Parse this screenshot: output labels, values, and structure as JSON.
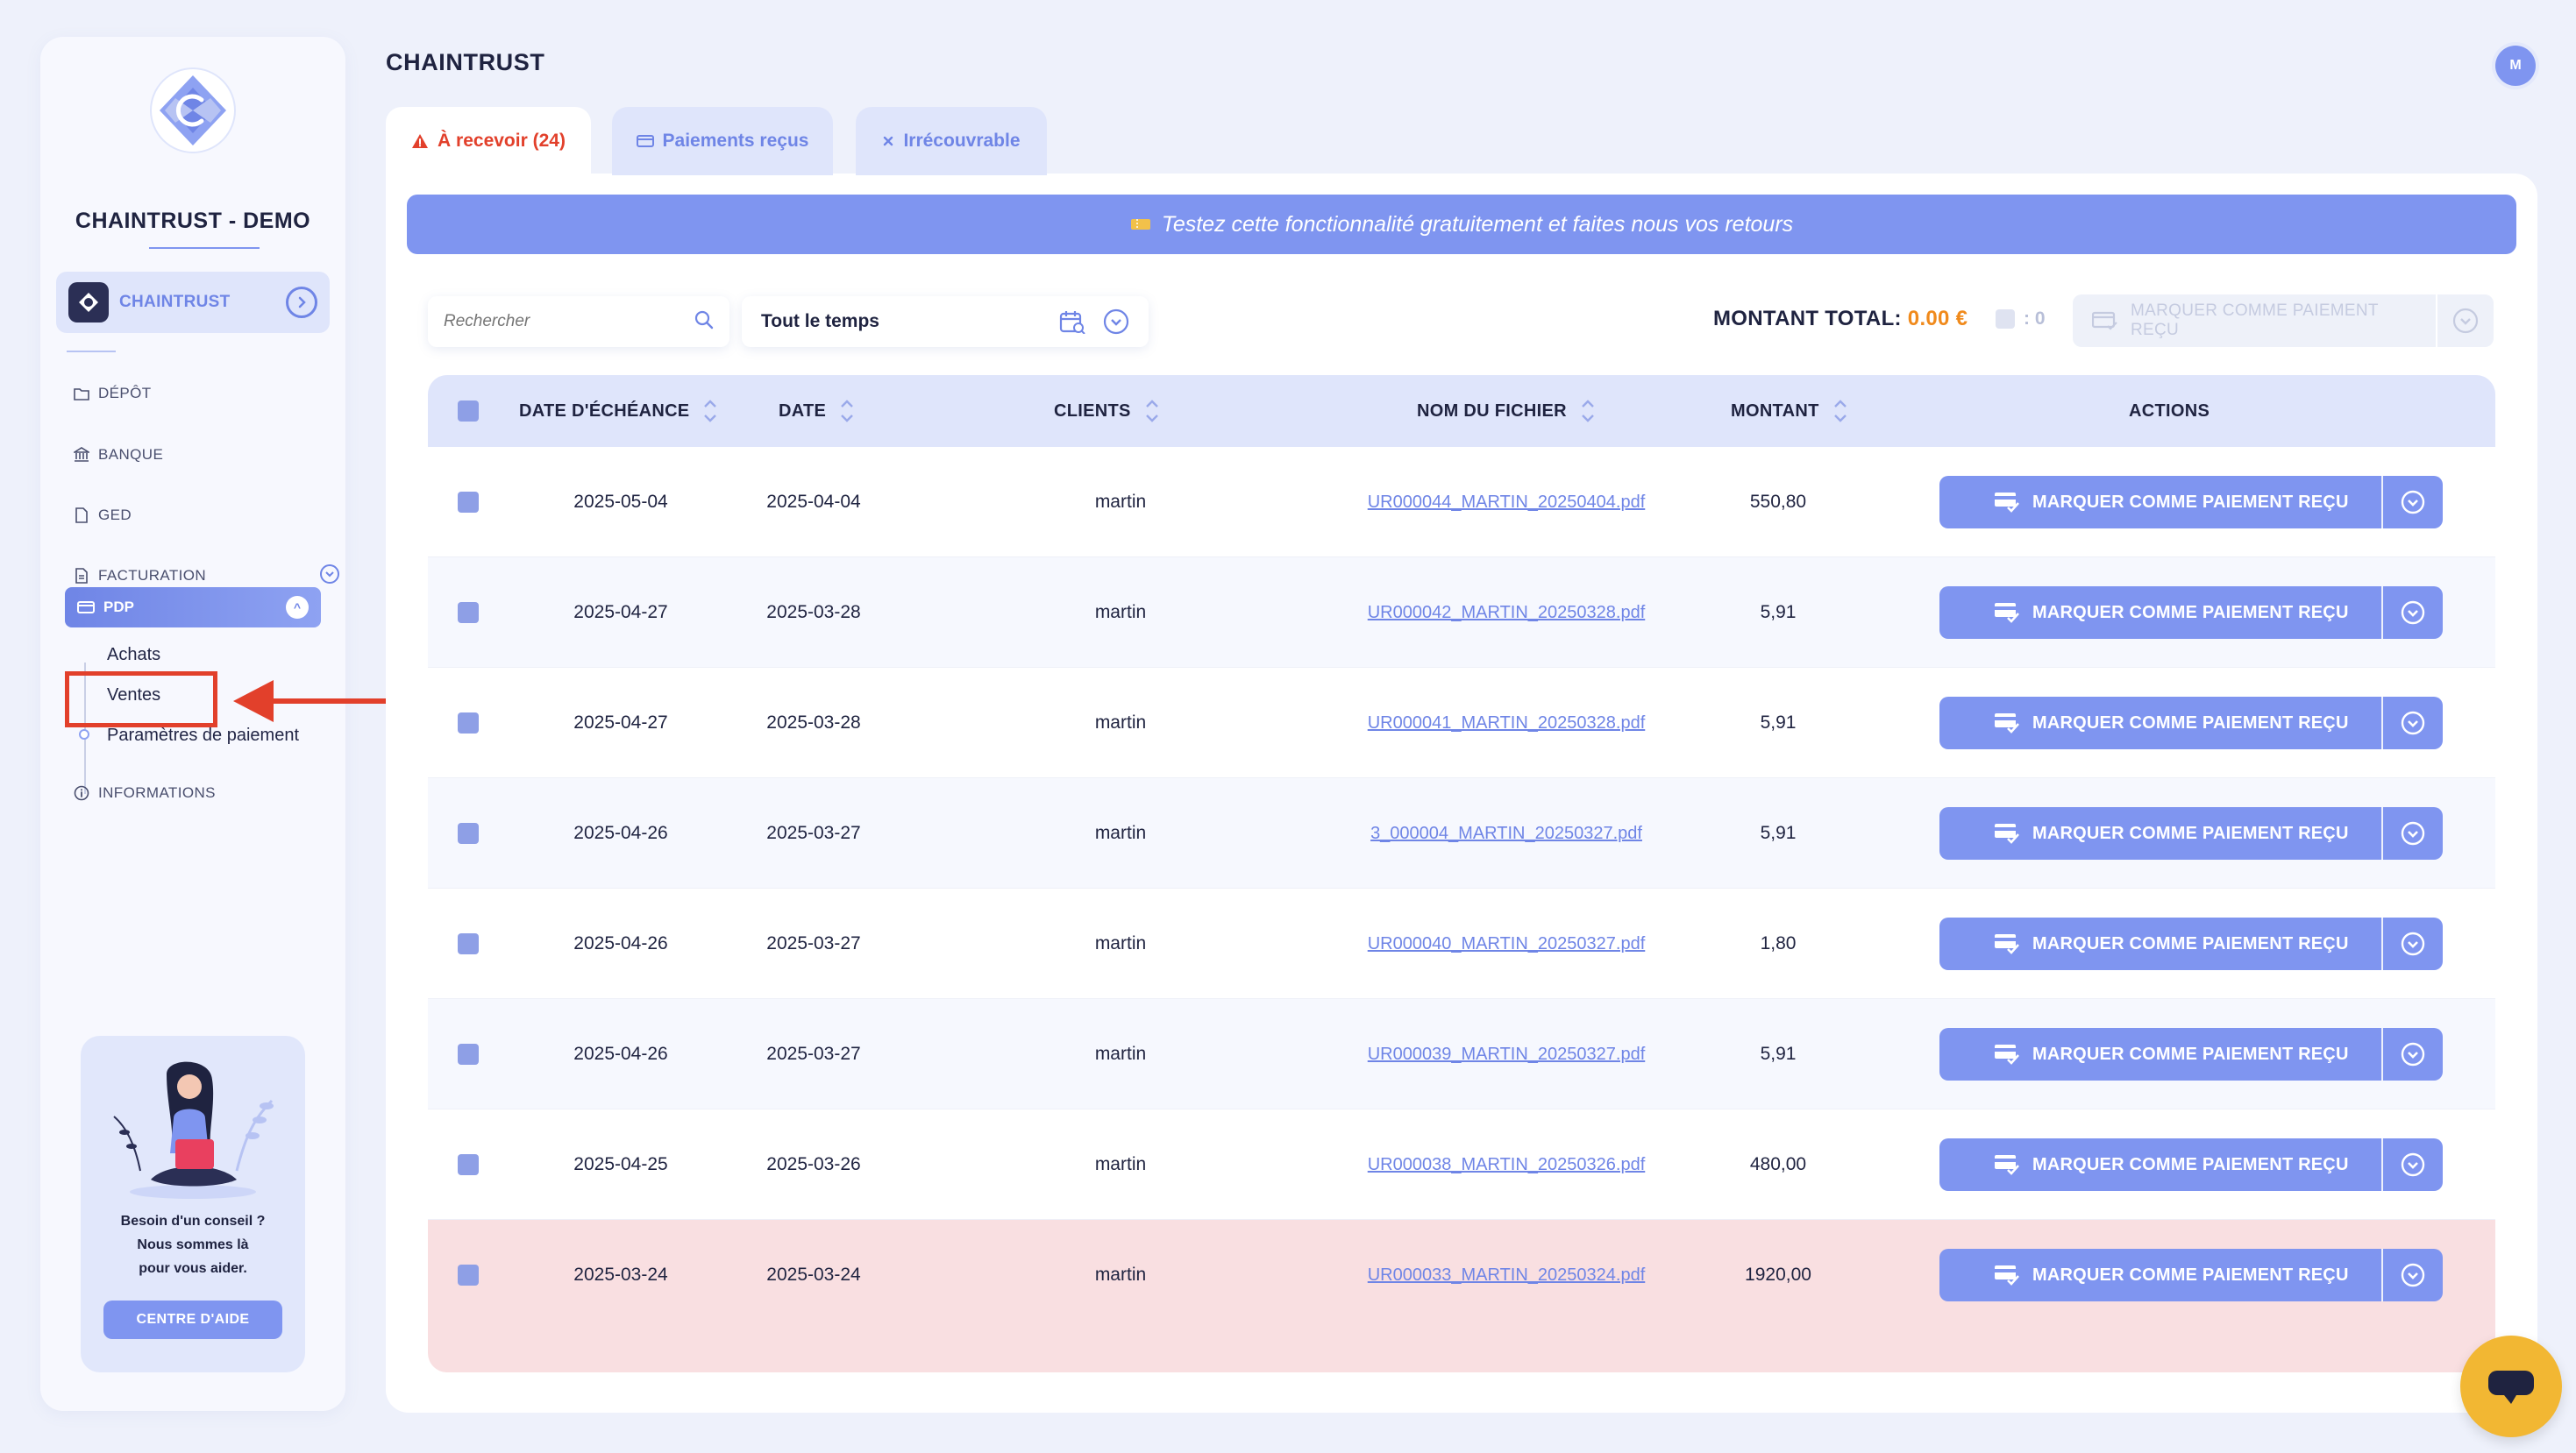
{
  "app": {
    "title": "CHAINTRUST",
    "avatar_initial": "M"
  },
  "sidebar": {
    "brand": "CHAINTRUST - DEMO",
    "org_label": "CHAINTRUST",
    "items": [
      {
        "label": "DÉPÔT",
        "icon": "folder-icon"
      },
      {
        "label": "BANQUE",
        "icon": "bank-icon"
      },
      {
        "label": "GED",
        "icon": "document-icon"
      },
      {
        "label": "FACTURATION",
        "icon": "invoice-icon"
      },
      {
        "label": "PDP",
        "icon": "card-icon"
      },
      {
        "label": "INFORMATIONS",
        "icon": "info-icon"
      }
    ],
    "pdp_sub": [
      "Achats",
      "Ventes",
      "Paramètres de paiement"
    ],
    "help": {
      "line1": "Besoin d'un conseil ?",
      "line2": "Nous sommes là",
      "line3": "pour vous aider.",
      "button": "CENTRE D'AIDE"
    }
  },
  "tabs": [
    {
      "label": "À recevoir (24)",
      "icon": "warning-icon"
    },
    {
      "label": "Paiements reçus",
      "icon": "card-icon"
    },
    {
      "label": "Irrécouvrable",
      "icon": "close-icon"
    }
  ],
  "banner": "Testez cette fonctionnalité gratuitement et faites nous vos retours",
  "toolbar": {
    "search_placeholder": "Rechercher",
    "period": "Tout le temps",
    "total_label": "MONTANT TOTAL:",
    "total_value": "0.00 €",
    "selected_count": ": 0",
    "bulk_button": "MARQUER COMME PAIEMENT REÇU"
  },
  "table": {
    "columns": [
      "DATE D'ÉCHÉANCE",
      "DATE",
      "CLIENTS",
      "NOM DU FICHIER",
      "MONTANT",
      "ACTIONS"
    ],
    "action_label": "MARQUER COMME PAIEMENT REÇU",
    "rows": [
      {
        "due": "2025-05-04",
        "date": "2025-04-04",
        "client": "martin",
        "file": "UR000044_MARTIN_20250404.pdf",
        "amount": "550,80",
        "overdue": false
      },
      {
        "due": "2025-04-27",
        "date": "2025-03-28",
        "client": "martin",
        "file": "UR000042_MARTIN_20250328.pdf",
        "amount": "5,91",
        "overdue": false
      },
      {
        "due": "2025-04-27",
        "date": "2025-03-28",
        "client": "martin",
        "file": "UR000041_MARTIN_20250328.pdf",
        "amount": "5,91",
        "overdue": false
      },
      {
        "due": "2025-04-26",
        "date": "2025-03-27",
        "client": "martin",
        "file": "3_000004_MARTIN_20250327.pdf",
        "amount": "5,91",
        "overdue": false
      },
      {
        "due": "2025-04-26",
        "date": "2025-03-27",
        "client": "martin",
        "file": "UR000040_MARTIN_20250327.pdf",
        "amount": "1,80",
        "overdue": false
      },
      {
        "due": "2025-04-26",
        "date": "2025-03-27",
        "client": "martin",
        "file": "UR000039_MARTIN_20250327.pdf",
        "amount": "5,91",
        "overdue": false
      },
      {
        "due": "2025-04-25",
        "date": "2025-03-26",
        "client": "martin",
        "file": "UR000038_MARTIN_20250326.pdf",
        "amount": "480,00",
        "overdue": false
      },
      {
        "due": "2025-03-24",
        "date": "2025-03-24",
        "client": "martin",
        "file": "UR000033_MARTIN_20250324.pdf",
        "amount": "1920,00",
        "overdue": true
      }
    ]
  },
  "colors": {
    "accent": "#7f95f0",
    "danger": "#e2402b",
    "warning": "#f08a1c",
    "overdue_row": "#f9dfe1"
  }
}
